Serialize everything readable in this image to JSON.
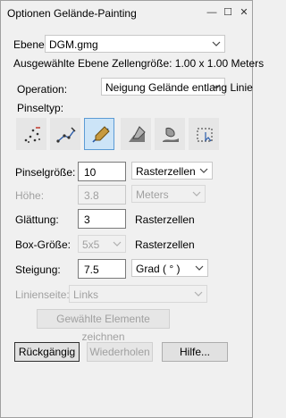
{
  "window": {
    "title": "Optionen Gelände-Painting",
    "min_glyph": "—",
    "max_glyph": "☐",
    "close_glyph": "✕"
  },
  "ebene": {
    "label": "Ebene",
    "value": "DGM.gmg"
  },
  "cell_size_text": "Ausgewählte Ebene Zellengröße: 1.00 x 1.00 Meters",
  "operation": {
    "label": "Operation:",
    "value": "Neigung Gelände entlang Linie"
  },
  "brush": {
    "label": "Pinseltyp:",
    "tools": [
      {
        "icon": "spray-dots-icon",
        "selected": false
      },
      {
        "icon": "line-points-icon",
        "selected": false
      },
      {
        "icon": "pen-brush-icon",
        "selected": true
      },
      {
        "icon": "fill-area-icon",
        "selected": false
      },
      {
        "icon": "smudge-icon",
        "selected": false
      },
      {
        "icon": "dotted-selection-icon",
        "selected": false
      }
    ]
  },
  "fields": {
    "brush_size": {
      "label": "Pinselgröße:",
      "value": "10",
      "unit": "Rasterzellen"
    },
    "height": {
      "label": "Höhe:",
      "value": "3.8",
      "unit": "Meters"
    },
    "smoothing": {
      "label": "Glättung:",
      "value": "3",
      "unit": "Rasterzellen"
    },
    "box_size": {
      "label": "Box-Größe:",
      "value": "5x5",
      "unit": "Rasterzellen"
    },
    "slope": {
      "label": "Steigung:",
      "value": "7.5",
      "unit": "Grad ( ° )"
    },
    "line_side": {
      "label": "Linienseite:",
      "value": "Links"
    }
  },
  "buttons": {
    "draw_selected": "Gewählte Elemente zeichnen",
    "undo": "Rückgängig",
    "redo": "Wiederholen",
    "help": "Hilfe..."
  }
}
